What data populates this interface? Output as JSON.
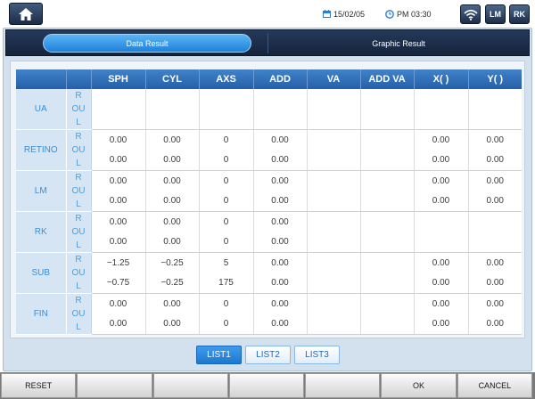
{
  "app": {
    "date": "15/02/05",
    "time": "PM 03:30",
    "lm_label": "LM",
    "rk_label": "RK"
  },
  "tabs": {
    "data_result": "Data Result",
    "graphic_result": "Graphic Result",
    "active": "data_result"
  },
  "table": {
    "columns": [
      "SPH",
      "CYL",
      "AXS",
      "ADD",
      "VA",
      "ADD VA",
      "X( )",
      "Y( )"
    ],
    "eye_labels": [
      "R",
      "OU",
      "L"
    ],
    "groups": [
      {
        "label": "UA",
        "rows": [
          [
            "",
            "",
            "",
            "",
            "",
            "",
            "",
            ""
          ],
          [
            "",
            "",
            "",
            "",
            "",
            "",
            "",
            ""
          ]
        ]
      },
      {
        "label": "RETINO",
        "rows": [
          [
            "0.00",
            "0.00",
            "0",
            "0.00",
            "",
            "",
            "0.00",
            "0.00"
          ],
          [
            "0.00",
            "0.00",
            "0",
            "0.00",
            "",
            "",
            "0.00",
            "0.00"
          ]
        ]
      },
      {
        "label": "LM",
        "rows": [
          [
            "0.00",
            "0.00",
            "0",
            "0.00",
            "",
            "",
            "0.00",
            "0.00"
          ],
          [
            "0.00",
            "0.00",
            "0",
            "0.00",
            "",
            "",
            "0.00",
            "0.00"
          ]
        ]
      },
      {
        "label": "RK",
        "rows": [
          [
            "0.00",
            "0.00",
            "0",
            "0.00",
            "",
            "",
            "",
            ""
          ],
          [
            "0.00",
            "0.00",
            "0",
            "0.00",
            "",
            "",
            "",
            ""
          ]
        ]
      },
      {
        "label": "SUB",
        "rows": [
          [
            "−1.25",
            "−0.25",
            "5",
            "0.00",
            "",
            "",
            "0.00",
            "0.00"
          ],
          [
            "−0.75",
            "−0.25",
            "175",
            "0.00",
            "",
            "",
            "0.00",
            "0.00"
          ]
        ]
      },
      {
        "label": "FIN",
        "rows": [
          [
            "0.00",
            "0.00",
            "0",
            "0.00",
            "",
            "",
            "0.00",
            "0.00"
          ],
          [
            "0.00",
            "0.00",
            "0",
            "0.00",
            "",
            "",
            "0.00",
            "0.00"
          ]
        ]
      }
    ]
  },
  "lists": [
    {
      "label": "LIST1",
      "active": true
    },
    {
      "label": "LIST2",
      "active": false
    },
    {
      "label": "LIST3",
      "active": false
    }
  ],
  "footer": [
    "RESET",
    "",
    "",
    "",
    "",
    "OK",
    "CANCEL"
  ],
  "icons": {
    "home": "home-icon",
    "date": "calendar-icon",
    "time": "clock-icon",
    "wifi": "wifi-icon"
  },
  "colors": {
    "accent": "#1f80da",
    "header_bg": "#2460a9",
    "navy": "#15243b",
    "label_text": "#3a8fd8",
    "label_bg": "#d6e5f3"
  }
}
